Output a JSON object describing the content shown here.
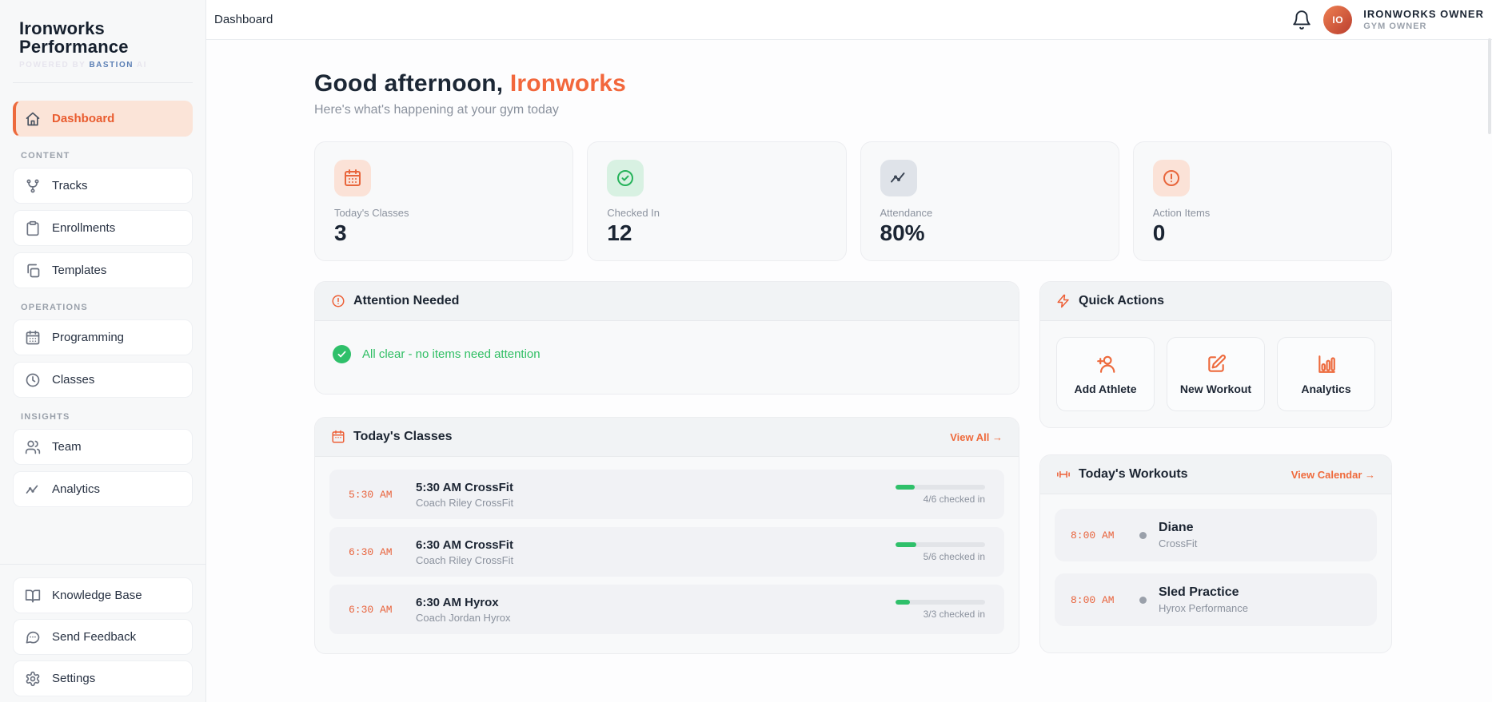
{
  "brand": {
    "name_line1": "Ironworks",
    "name_line2": "Performance",
    "powered_by": "POWERED BY",
    "powered_brand": "BASTION",
    "powered_suffix": "AI"
  },
  "header": {
    "page_title": "Dashboard",
    "user_initials": "IO",
    "user_name": "IRONWORKS OWNER",
    "user_role": "GYM OWNER"
  },
  "sidebar": {
    "dashboard": {
      "label": "Dashboard"
    },
    "sections": [
      {
        "label": "CONTENT",
        "items": [
          {
            "label": "Tracks"
          },
          {
            "label": "Enrollments"
          },
          {
            "label": "Templates"
          }
        ]
      },
      {
        "label": "OPERATIONS",
        "items": [
          {
            "label": "Programming"
          },
          {
            "label": "Classes"
          }
        ]
      },
      {
        "label": "INSIGHTS",
        "items": [
          {
            "label": "Team"
          },
          {
            "label": "Analytics"
          }
        ]
      }
    ],
    "footer_items": [
      {
        "label": "Knowledge Base"
      },
      {
        "label": "Send Feedback"
      },
      {
        "label": "Settings"
      }
    ]
  },
  "greeting": {
    "prefix": "Good afternoon,",
    "name": "Ironworks",
    "subtitle": "Here's what's happening at your gym today"
  },
  "stats": [
    {
      "label": "Today's Classes",
      "value": "3"
    },
    {
      "label": "Checked In",
      "value": "12"
    },
    {
      "label": "Attendance",
      "value": "80%"
    },
    {
      "label": "Action Items",
      "value": "0"
    }
  ],
  "attention": {
    "title": "Attention Needed",
    "message": "All clear - no items need attention"
  },
  "quick_actions": {
    "title": "Quick Actions",
    "actions": [
      {
        "label": "Add Athlete"
      },
      {
        "label": "New Workout"
      },
      {
        "label": "Analytics"
      }
    ]
  },
  "todays_classes": {
    "title": "Today's Classes",
    "view_all": "View All →",
    "rows": [
      {
        "time": "5:30 AM",
        "title": "5:30 AM CrossFit",
        "coach": "Coach Riley CrossFit",
        "checkin": "4/6 checked in",
        "progress_pct": 21
      },
      {
        "time": "6:30 AM",
        "title": "6:30 AM CrossFit",
        "coach": "Coach Riley CrossFit",
        "checkin": "5/6 checked in",
        "progress_pct": 23
      },
      {
        "time": "6:30 AM",
        "title": "6:30 AM Hyrox",
        "coach": "Coach Jordan Hyrox",
        "checkin": "3/3 checked in",
        "progress_pct": 16
      }
    ]
  },
  "todays_workouts": {
    "title": "Today's Workouts",
    "view_calendar": "View Calendar →",
    "rows": [
      {
        "time": "8:00 AM",
        "title": "Diane",
        "program": "CrossFit"
      },
      {
        "time": "8:00 AM",
        "title": "Sled Practice",
        "program": "Hyrox Performance"
      }
    ]
  },
  "colors": {
    "accent": "#ED6A3D",
    "green": "#2FC06A",
    "navy": "#1C2533",
    "muted": "#8B929E",
    "steel_blue": "#5B7FB5"
  }
}
